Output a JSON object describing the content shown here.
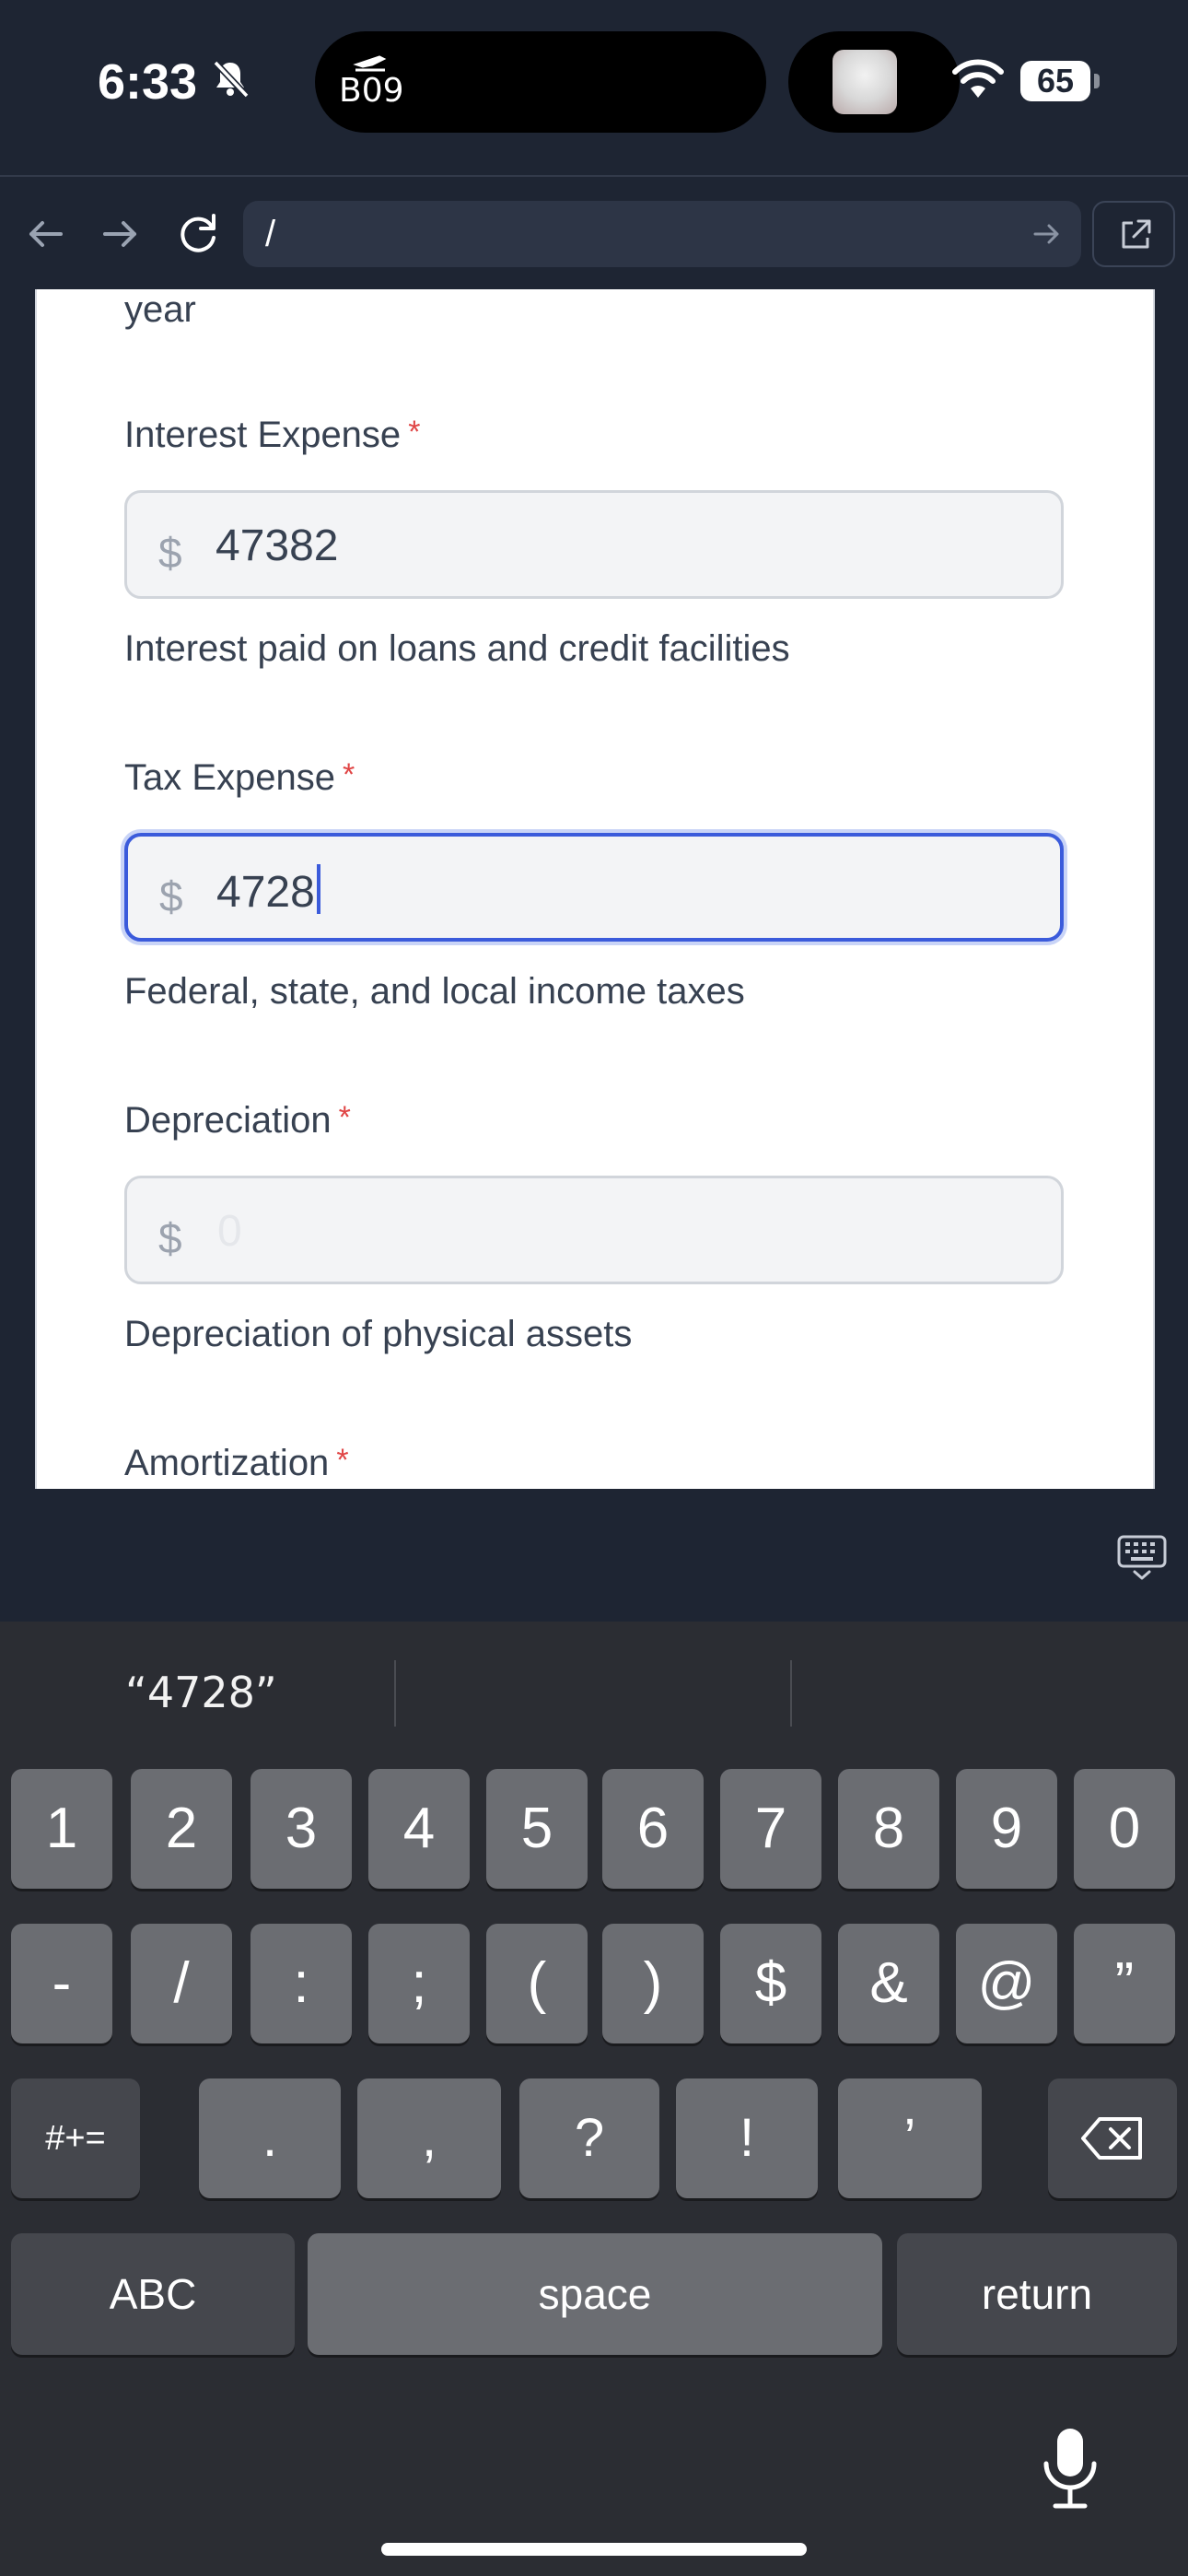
{
  "status_bar": {
    "time": "6:33",
    "island_text": "B09",
    "battery": "65"
  },
  "browser": {
    "url": "/"
  },
  "form": {
    "prev_fragment": "year",
    "fields": [
      {
        "label": "Interest Expense",
        "required_mark": "*",
        "currency": "$",
        "value": "47382",
        "placeholder": "",
        "help": "Interest paid on loans and credit facilities"
      },
      {
        "label": "Tax Expense",
        "required_mark": "*",
        "currency": "$",
        "value": "4728",
        "placeholder": "",
        "help": "Federal, state, and local income taxes"
      },
      {
        "label": "Depreciation",
        "required_mark": "*",
        "currency": "$",
        "value": "",
        "placeholder": "0",
        "help": "Depreciation of physical assets"
      },
      {
        "label": "Amortization",
        "required_mark": "*"
      }
    ]
  },
  "keyboard": {
    "suggestion": "“4728”",
    "row1": [
      "1",
      "2",
      "3",
      "4",
      "5",
      "6",
      "7",
      "8",
      "9",
      "0"
    ],
    "row2": [
      "-",
      "/",
      ":",
      ";",
      "(",
      ")",
      "$",
      "&",
      "@",
      "”"
    ],
    "row3_left": "#+=",
    "row3": [
      ".",
      ",",
      "?",
      "!",
      "’"
    ],
    "abc": "ABC",
    "space": "space",
    "return": "return"
  },
  "colors": {
    "chrome_bg": "#1e2533",
    "focus_border": "#3b5bdb",
    "required": "#e04545"
  }
}
